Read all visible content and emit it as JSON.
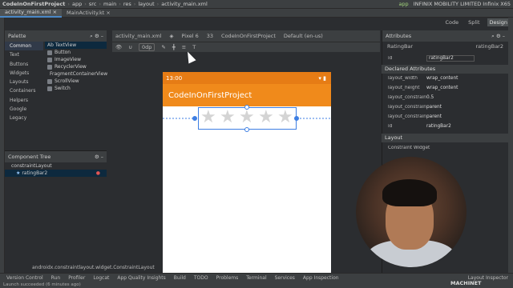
{
  "nav": {
    "items": [
      "CodeInOnFirstProject",
      "app",
      "src",
      "main",
      "res",
      "layout",
      "activity_main.xml"
    ],
    "run_config": "app",
    "device": "INFINIX MOBILITY LIMITED Infinix X65"
  },
  "tabs": [
    {
      "label": "activity_main.xml",
      "active": true
    },
    {
      "label": "MainActivity.kt",
      "active": false
    }
  ],
  "modes": {
    "code": "Code",
    "split": "Split",
    "design": "Design"
  },
  "palette": {
    "title": "Palette",
    "categories": [
      "Common",
      "Text",
      "Buttons",
      "Widgets",
      "Layouts",
      "Containers",
      "Helpers",
      "Google",
      "Legacy"
    ],
    "items": [
      "Ab TextView",
      "Button",
      "ImageView",
      "RecyclerView",
      "FragmentContainerView",
      "ScrollView",
      "Switch"
    ]
  },
  "tree": {
    "title": "Component Tree",
    "items": [
      "constraintLayout",
      "ratingBar2"
    ]
  },
  "design_toolbar": {
    "file": "activity_main.xml",
    "device": "Pixel 6",
    "api": "33",
    "theme": "CodeInOnFirstProject",
    "locale": "Default (en-us)",
    "margin": "0dp"
  },
  "phone": {
    "time": "13:00",
    "app_title": "CodeInOnFirstProject",
    "stars": 5
  },
  "attributes": {
    "title": "Attributes",
    "widget": "RatingBar",
    "id_label": "id",
    "id_value": "ratingBar2",
    "declared_title": "Declared Attributes",
    "rows": [
      {
        "k": "layout_width",
        "v": "wrap_content"
      },
      {
        "k": "layout_height",
        "v": "wrap_content"
      },
      {
        "k": "layout_constraintHor...",
        "v": "0.5"
      },
      {
        "k": "layout_constraintEnd...",
        "v": "parent"
      },
      {
        "k": "layout_constraintStar...",
        "v": "parent"
      },
      {
        "k": "id",
        "v": "ratingBar2"
      }
    ],
    "layout_title": "Layout",
    "layout_value": "Constraint Widget"
  },
  "breadcrumb": "androidx.constraintlayout.widget.ConstraintLayout",
  "bottom": [
    "Version Control",
    "Run",
    "Profiler",
    "Logcat",
    "App Quality Insights",
    "Build",
    "TODO",
    "Problems",
    "Terminal",
    "Services",
    "App Inspection"
  ],
  "layout_inspector": "Layout Inspector",
  "status": "Launch succeeded (6 minutes ago)",
  "watermark": "MACHINET"
}
